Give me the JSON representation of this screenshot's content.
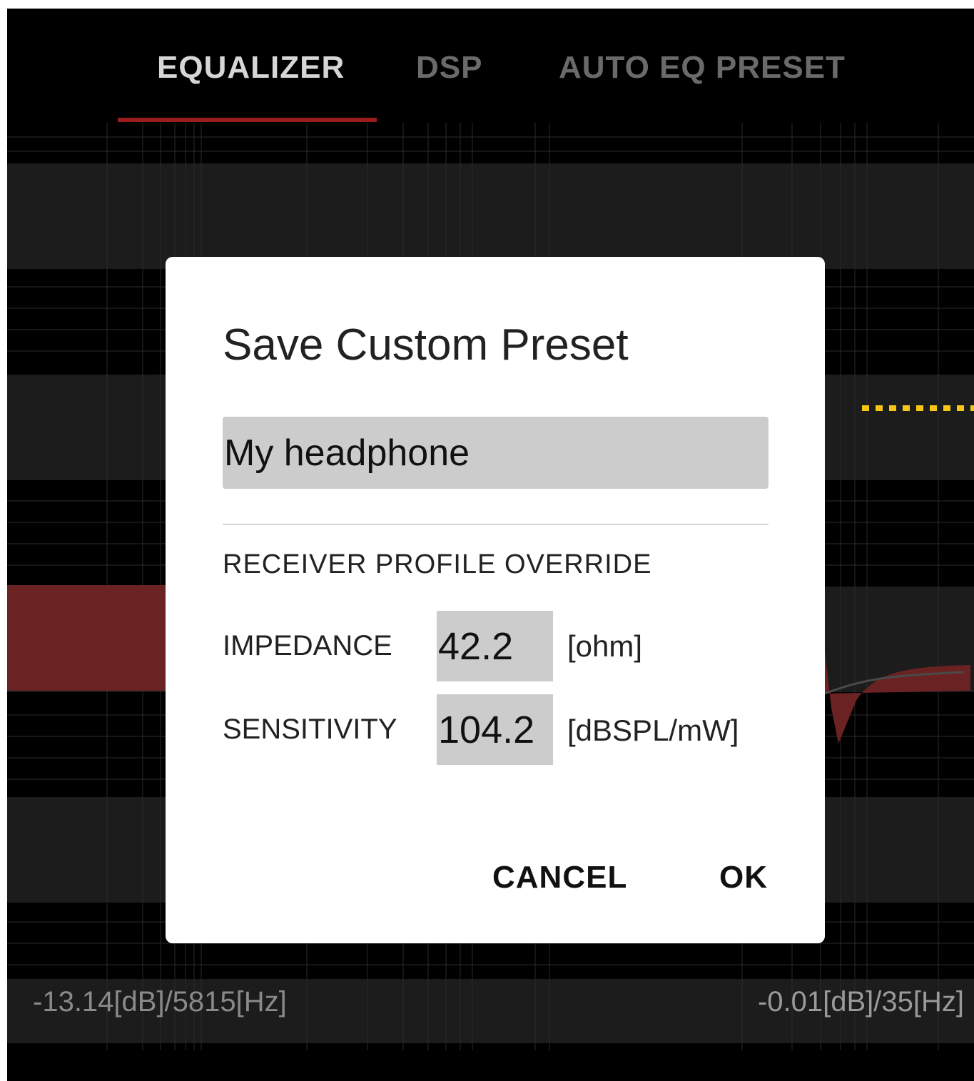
{
  "tabs": [
    {
      "label": "EQUALIZER",
      "active": true
    },
    {
      "label": "DSP",
      "active": false
    },
    {
      "label": "AUTO EQ PRESET",
      "active": false
    }
  ],
  "readouts": {
    "left": "-13.14[dB]/5815[Hz]",
    "right": "-0.01[dB]/35[Hz]"
  },
  "colors": {
    "accent": "#9b1c1c",
    "curve_fill": "#6b2222",
    "marker": "#f5c518",
    "dialog_bg": "#ffffff",
    "input_bg": "#cccccc"
  },
  "dialog": {
    "title": "Save Custom Preset",
    "name_value": "My headphone",
    "section_label": "RECEIVER PROFILE OVERRIDE",
    "impedance": {
      "label": "IMPEDANCE",
      "value": "42.2",
      "unit": "[ohm]"
    },
    "sensitivity": {
      "label": "SENSITIVITY",
      "value": "104.2",
      "unit": "[dBSPL/mW]"
    },
    "cancel_label": "CANCEL",
    "ok_label": "OK"
  }
}
